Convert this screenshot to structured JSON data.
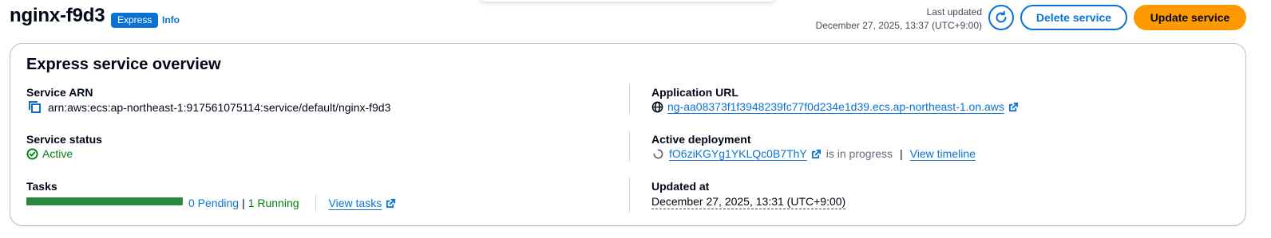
{
  "header": {
    "title": "nginx-f9d3",
    "badge": "Express",
    "info_label": "Info",
    "last_updated_label": "Last updated",
    "last_updated_value": "December 27, 2025, 13:37 (UTC+9:00)",
    "refresh_icon": "refresh-icon",
    "delete_label": "Delete service",
    "update_label": "Update service"
  },
  "overview": {
    "title": "Express service overview",
    "service_arn": {
      "label": "Service ARN",
      "value": "arn:aws:ecs:ap-northeast-1:917561075114:service/default/nginx-f9d3",
      "icon": "copy-icon"
    },
    "service_status": {
      "label": "Service status",
      "value": "Active",
      "icon": "check-circle-icon"
    },
    "tasks": {
      "label": "Tasks",
      "pending": "0 Pending",
      "separator": "|",
      "running": "1 Running",
      "running_fraction": 1.0,
      "view_tasks_label": "View tasks"
    },
    "application_url": {
      "label": "Application URL",
      "value": "ng-aa08373f1f3948239fc77f0d234e1d39.ecs.ap-northeast-1.on.aws",
      "icon": "globe-icon"
    },
    "active_deployment": {
      "label": "Active deployment",
      "deployment_id": "fO6ziKGYg1YKLQc0B7ThY",
      "status_text": "is in progress",
      "separator": "|",
      "view_timeline_label": "View timeline",
      "icon": "loading-spinner-icon"
    },
    "updated_at": {
      "label": "Updated at",
      "value": "December 27, 2025, 13:31 (UTC+9:00)"
    }
  },
  "colors": {
    "primary": "#0972d3",
    "accent": "#ff9900",
    "success": "#037f0c",
    "progress": "#29883b",
    "text": "#000716"
  }
}
